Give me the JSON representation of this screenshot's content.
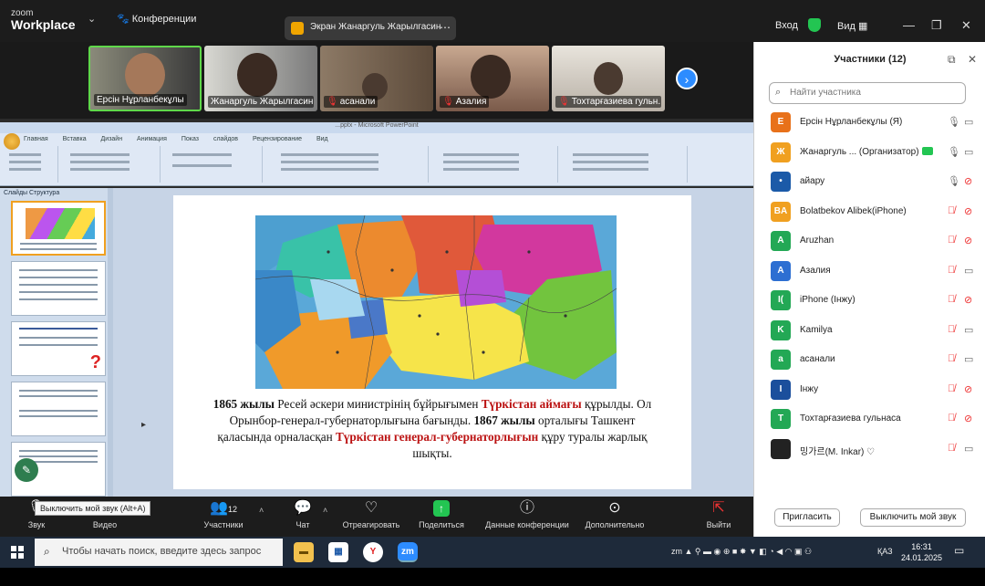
{
  "topbar": {
    "logo_small": "zoom",
    "logo_big": "Workplace",
    "conference_tab": "Конференции",
    "screen_tab": "Экран Жанаргуль Жарылгасин",
    "join": "Вход",
    "view": "Вид"
  },
  "videos": [
    {
      "name": "Ерсін Нұрланбекұлы",
      "muted": false,
      "active": true
    },
    {
      "name": "Жанаргуль Жарылгасин",
      "muted": false,
      "active": false
    },
    {
      "name": "асанали",
      "muted": true,
      "active": false
    },
    {
      "name": "Азалия",
      "muted": true,
      "active": false
    },
    {
      "name": "Тохтарғазиева гульн...",
      "muted": true,
      "active": false
    }
  ],
  "ppt": {
    "window_title": "...pptx - Microsoft PowerPoint",
    "tabs": "Главная Вставка Дизайн Анимация Показ слайдов Рецензирование Вид",
    "left_tabs": "Слайды  Структура",
    "slide_text": {
      "p1_year": "1865 жылы",
      "p1_a": " Ресей әскери министрінің бұйрығымен ",
      "p1_red": "Түркістан аймағы",
      "p1_b": " құрылды. Ол Орынбор-генерал-губернаторлығына бағынды. ",
      "p1_year2": "1867 жылы",
      "p1_c": " орталығы Ташкент қаласында орналасқан ",
      "p1_red2": "Түркістан генерал-губернаторлығын",
      "p1_d": " құру туралы жарлық шықты."
    }
  },
  "toolbar": {
    "audio": "Звук",
    "video": "Видео",
    "participants": "Участники",
    "participants_count": "12",
    "chat": "Чат",
    "react": "Отреагировать",
    "share": "Поделиться",
    "info": "Данные конференции",
    "more": "Дополнительно",
    "leave": "Выйти",
    "tooltip": "Выключить мой звук (Alt+A)"
  },
  "panel": {
    "title": "Участники (12)",
    "search_placeholder": "Найти участника",
    "participants": [
      {
        "initial": "E",
        "color": "#e8711a",
        "name": "Ерсін Нұрланбекұлы (Я)",
        "host": false,
        "mic": "on",
        "cam": "on"
      },
      {
        "initial": "Ж",
        "color": "#f0a020",
        "name": "Жанаргуль ... (Организатор)",
        "host": true,
        "mic": "on",
        "cam": "on"
      },
      {
        "initial": "•",
        "color": "#1b5aa8",
        "name": "айару",
        "host": false,
        "mic": "on",
        "cam": "off"
      },
      {
        "initial": "BA",
        "color": "#f0a020",
        "name": " Bolatbekov Alibek(iPhone)",
        "host": false,
        "mic": "off",
        "cam": "off"
      },
      {
        "initial": "A",
        "color": "#23a855",
        "name": "Aruzhan",
        "host": false,
        "mic": "off",
        "cam": "off"
      },
      {
        "initial": "A",
        "color": "#2d6fd2",
        "name": "Азалия",
        "host": false,
        "mic": "off",
        "cam": "on"
      },
      {
        "initial": "I(",
        "color": "#23a855",
        "name": "iPhone (Інжу)",
        "host": false,
        "mic": "off",
        "cam": "off"
      },
      {
        "initial": "K",
        "color": "#23a855",
        "name": "Kamilya",
        "host": false,
        "mic": "off",
        "cam": "on"
      },
      {
        "initial": "a",
        "color": "#23a855",
        "name": "асанали",
        "host": false,
        "mic": "off",
        "cam": "on"
      },
      {
        "initial": "I",
        "color": "#1b4f9c",
        "name": "Інжу",
        "host": false,
        "mic": "off",
        "cam": "off"
      },
      {
        "initial": "T",
        "color": "#23a855",
        "name": "Тохтарғазиева гульнаса",
        "host": false,
        "mic": "off",
        "cam": "off"
      },
      {
        "initial": "",
        "color": "#222222",
        "name": "밍가르(M. Inkar) ♡",
        "host": false,
        "mic": "off",
        "cam": "on"
      }
    ],
    "invite": "Пригласить",
    "mute_me": "Выключить мой звук"
  },
  "taskbar": {
    "search_placeholder": "Чтобы начать поиск, введите здесь запрос",
    "lang": "ҚАЗ",
    "time": "16:31",
    "date": "24.01.2025"
  },
  "colors": {
    "zoom_blue": "#2d8cff",
    "zoom_green": "#23c552",
    "muted_red": "#e33333"
  }
}
